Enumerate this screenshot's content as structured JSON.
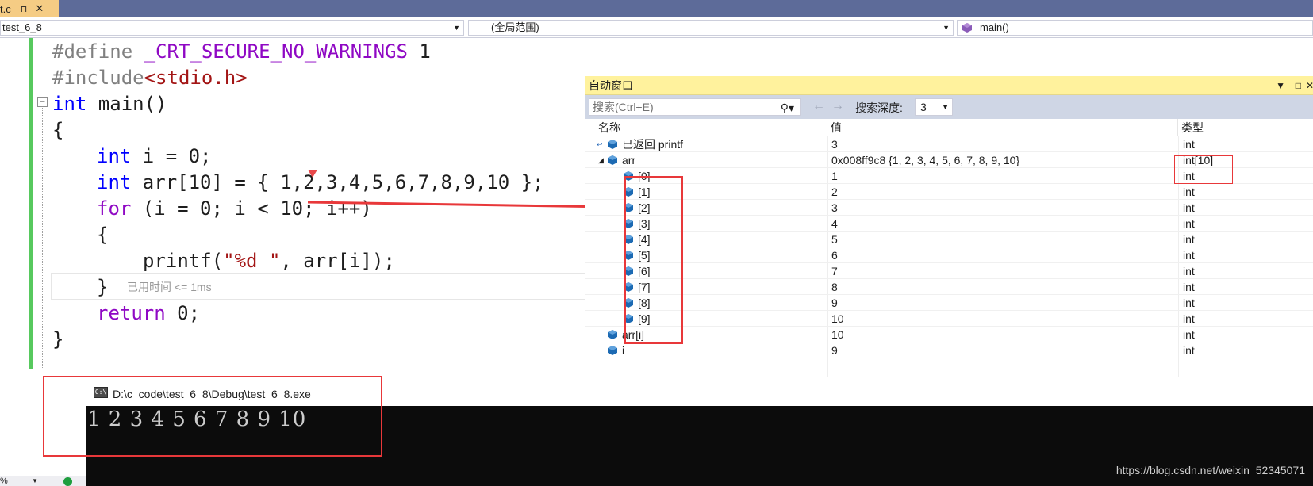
{
  "tab": {
    "name": "t.c",
    "pin": "⊓",
    "close": "✕"
  },
  "navbar": {
    "project": "test_6_8",
    "scope": "(全局范围)",
    "function": "main()"
  },
  "code": {
    "line1_kw": "#define",
    "line1_macro": "_CRT_SECURE_NO_WARNINGS",
    "line1_val": "1",
    "line2_kw": "#include",
    "line2_inc": "<stdio.h>",
    "line3_kw": "int",
    "line3_rest": " main()",
    "line4": "{",
    "line5_kw": "int",
    "line5_rest": " i = 0;",
    "line6_kw": "int",
    "line6_rest": " arr[10] = { 1,2,3,4,5,6,7,8,9,10 };",
    "line7_kw": "for",
    "line7_rest": " (i = 0; i < 10; i++)",
    "line8": "{",
    "line9_fn": "printf(",
    "line9_str": "\"%d \"",
    "line9_rest": ", arr[i]);",
    "line10": "}",
    "line11_kw": "return",
    "line11_rest": " 0;",
    "line12": "}",
    "elapsed_hint": "已用时间 <= 1ms"
  },
  "autos": {
    "title": "自动窗口",
    "search_placeholder": "搜索(Ctrl+E)",
    "depth_label": "搜索深度:",
    "depth_value": "3",
    "columns": {
      "name": "名称",
      "value": "值",
      "type": "类型"
    },
    "rows": [
      {
        "name": "已返回 printf",
        "value": "3",
        "type": "int"
      },
      {
        "name": "arr",
        "value": "0x008ff9c8 {1, 2, 3, 4, 5, 6, 7, 8, 9, 10}",
        "type": "int[10]"
      },
      {
        "name": "[0]",
        "value": "1",
        "type": "int"
      },
      {
        "name": "[1]",
        "value": "2",
        "type": "int"
      },
      {
        "name": "[2]",
        "value": "3",
        "type": "int"
      },
      {
        "name": "[3]",
        "value": "4",
        "type": "int"
      },
      {
        "name": "[4]",
        "value": "5",
        "type": "int"
      },
      {
        "name": "[5]",
        "value": "6",
        "type": "int"
      },
      {
        "name": "[6]",
        "value": "7",
        "type": "int"
      },
      {
        "name": "[7]",
        "value": "8",
        "type": "int"
      },
      {
        "name": "[8]",
        "value": "9",
        "type": "int"
      },
      {
        "name": "[9]",
        "value": "10",
        "type": "int"
      },
      {
        "name": "arr[i]",
        "value": "10",
        "type": "int"
      },
      {
        "name": "i",
        "value": "9",
        "type": "int"
      }
    ]
  },
  "console": {
    "title": "D:\\c_code\\test_6_8\\Debug\\test_6_8.exe",
    "icon_text": "C:\\",
    "output": "1 2 3 4 5 6 7 8 9 10"
  },
  "status": {
    "zoom": "%"
  },
  "watermark": "https://blog.csdn.net/weixin_52345071",
  "colors": {
    "accent_red": "#e8383a",
    "tab_active": "#f5cc84",
    "autos_title": "#fff29d",
    "change_bar": "#57c95e"
  }
}
